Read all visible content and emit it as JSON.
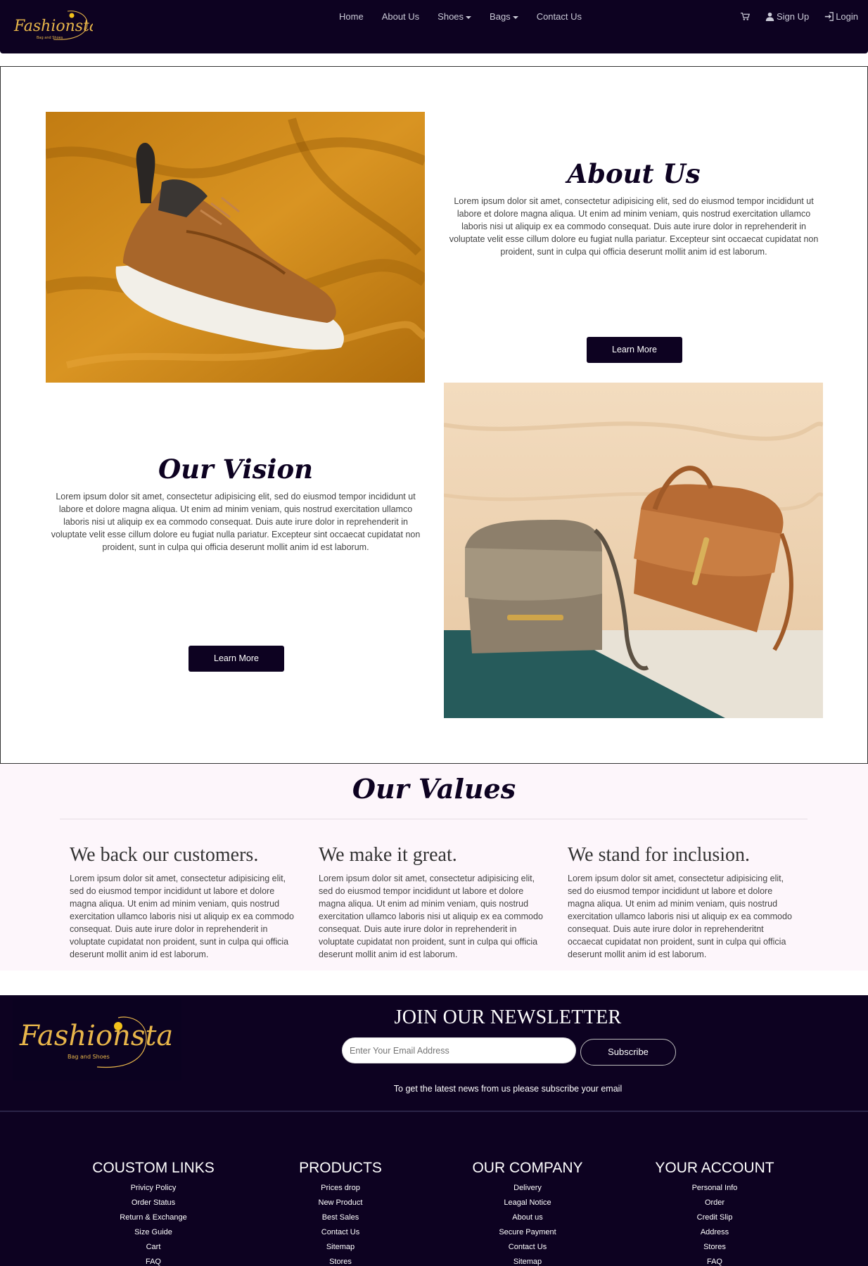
{
  "brand": {
    "logo_text": "Fashionsta",
    "logo_tagline": "Bag and Shoes",
    "logo_color": "#e8b64a",
    "primary_dark": "#0d0221"
  },
  "nav": {
    "links": [
      "Home",
      "About Us",
      "Shoes",
      "Bags",
      "Contact Us"
    ],
    "sign_up": "Sign Up",
    "login": "Login"
  },
  "about": {
    "title": "About Us",
    "text": "Lorem ipsum dolor sit amet, consectetur adipisicing elit, sed do eiusmod tempor incididunt ut labore et dolore magna aliqua. Ut enim ad minim veniam, quis nostrud exercitation ullamco laboris nisi ut aliquip ex ea commodo consequat. Duis aute irure dolor in reprehenderit in voluptate velit esse cillum dolore eu fugiat nulla pariatur. Excepteur sint occaecat cupidatat non proident, sunt in culpa qui officia deserunt mollit anim id est laborum.",
    "button": "Learn More"
  },
  "vision": {
    "title": "Our Vision",
    "text": "Lorem ipsum dolor sit amet, consectetur adipisicing elit, sed do eiusmod tempor incididunt ut labore et dolore magna aliqua. Ut enim ad minim veniam, quis nostrud exercitation ullamco laboris nisi ut aliquip ex ea commodo consequat. Duis aute irure dolor in reprehenderit in voluptate velit esse cillum dolore eu fugiat nulla pariatur. Excepteur sint occaecat cupidatat non proident, sunt in culpa qui officia deserunt mollit anim id est laborum.",
    "button": "Learn More"
  },
  "values": {
    "title": "Our Values",
    "items": [
      {
        "heading": "We back our customers.",
        "text": "Lorem ipsum dolor sit amet, consectetur adipisicing elit, sed do eiusmod tempor incididunt ut labore et dolore magna aliqua. Ut enim ad minim veniam, quis nostrud exercitation ullamco laboris nisi ut aliquip ex ea commodo consequat. Duis aute irure dolor in reprehenderit in voluptate cupidatat non proident, sunt in culpa qui officia deserunt mollit anim id est laborum."
      },
      {
        "heading": "We make it great.",
        "text": "Lorem ipsum dolor sit amet, consectetur adipisicing elit, sed do eiusmod tempor incididunt ut labore et dolore magna aliqua. Ut enim ad minim veniam, quis nostrud exercitation ullamco laboris nisi ut aliquip ex ea commodo consequat. Duis aute irure dolor in reprehenderit in voluptate cupidatat non proident, sunt in culpa qui officia deserunt mollit anim id est laborum."
      },
      {
        "heading": "We stand for inclusion.",
        "text": "Lorem ipsum dolor sit amet, consectetur adipisicing elit, sed do eiusmod tempor incididunt ut labore et dolore magna aliqua. Ut enim ad minim veniam, quis nostrud exercitation ullamco laboris nisi ut aliquip ex ea commodo consequat. Duis aute irure dolor in reprehenderitnt occaecat cupidatat non proident, sunt in culpa qui officia deserunt mollit anim id est laborum."
      }
    ]
  },
  "newsletter": {
    "title": "JOIN OUR NEWSLETTER",
    "placeholder": "Enter Your Email Address",
    "button": "Subscribe",
    "subtext": "To get the latest news from us please subscribe your email"
  },
  "footer": {
    "columns": [
      {
        "title": "COUSTOM LINKS",
        "links": [
          "Privicy Policy",
          "Order Status",
          "Return & Exchange",
          "Size Guide",
          "Cart",
          "FAQ"
        ]
      },
      {
        "title": "PRODUCTS",
        "links": [
          "Prices drop",
          "New Product",
          "Best Sales",
          "Contact Us",
          "Sitemap",
          "Stores"
        ]
      },
      {
        "title": "OUR COMPANY",
        "links": [
          "Delivery",
          "Leagal Notice",
          "About us",
          "Secure Payment",
          "Contact Us",
          "Sitemap"
        ]
      },
      {
        "title": "YOUR ACCOUNT",
        "links": [
          "Personal Info",
          "Order",
          "Credit Slip",
          "Address",
          "Stores",
          "FAQ"
        ]
      }
    ]
  }
}
